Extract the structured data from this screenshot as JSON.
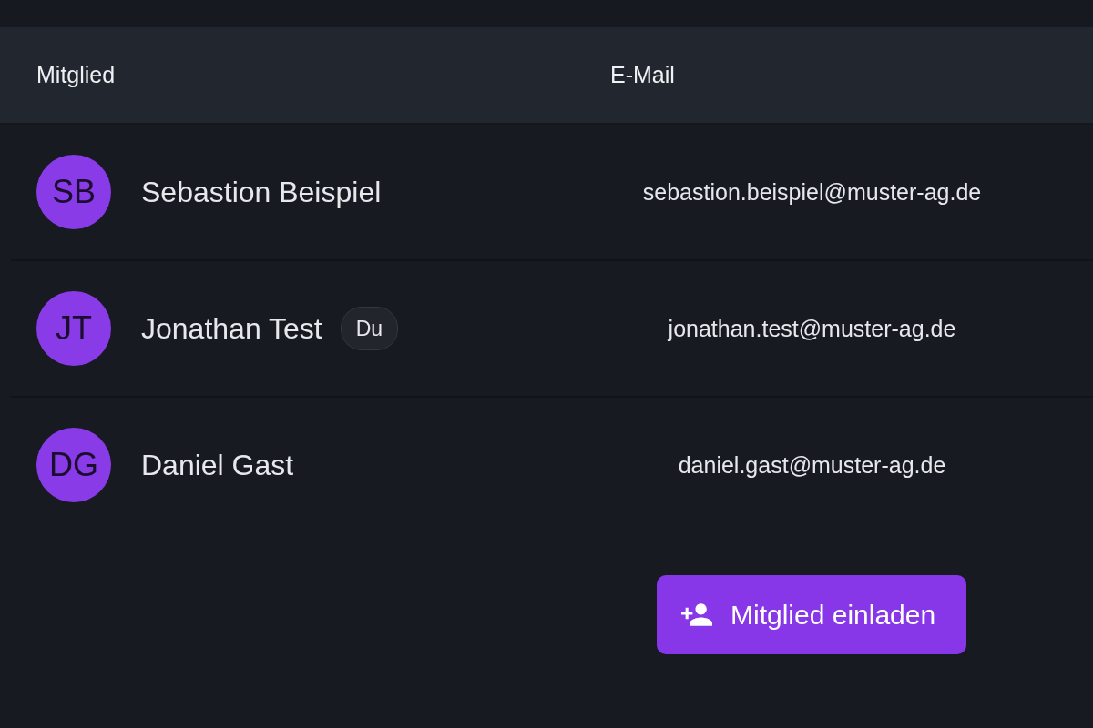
{
  "table": {
    "columns": [
      "Mitglied",
      "E-Mail"
    ],
    "rows": [
      {
        "initials": "SB",
        "name": "Sebastion Beispiel",
        "email": "sebastion.beispiel@muster-ag.de"
      },
      {
        "initials": "JT",
        "name": "Jonathan Test",
        "badge": "Du",
        "email": "jonathan.test@muster-ag.de"
      },
      {
        "initials": "DG",
        "name": "Daniel Gast",
        "email": "daniel.gast@muster-ag.de"
      }
    ]
  },
  "invite_button": {
    "label": "Mitglied einladen"
  }
}
